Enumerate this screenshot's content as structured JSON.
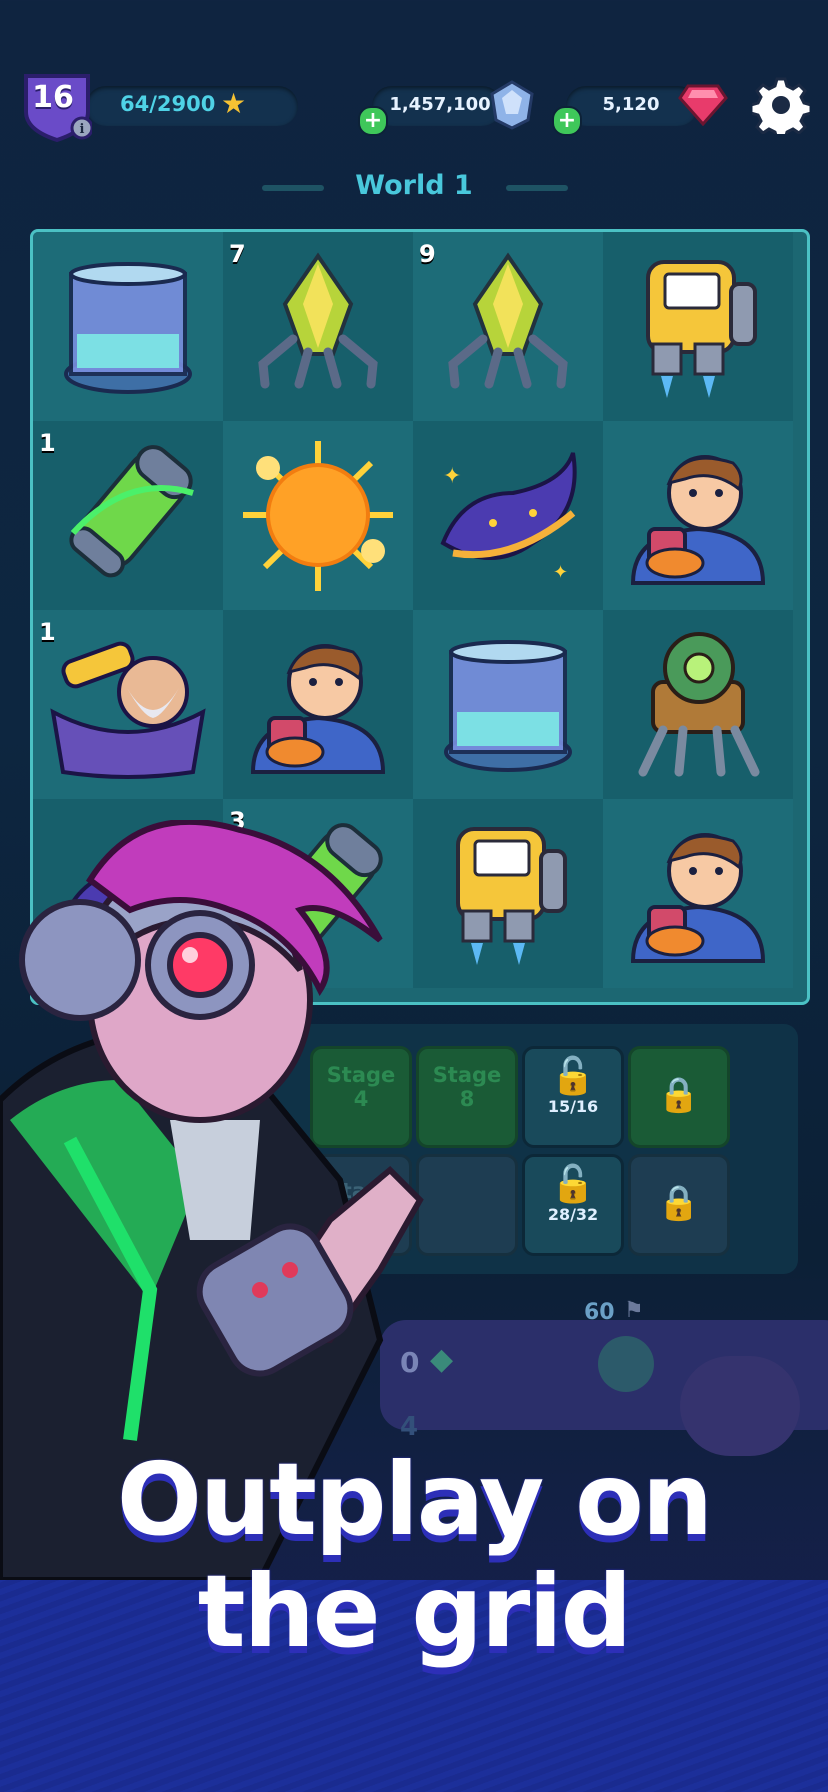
{
  "header": {
    "level": "16",
    "xp": "64/2900",
    "coins": "1,457,100",
    "gems": "5,120"
  },
  "world_title": "World 1",
  "grid": {
    "cells": [
      {
        "item": "cryo-tank-icon",
        "count": ""
      },
      {
        "item": "crystal-drone-icon",
        "count": "7"
      },
      {
        "item": "crystal-drone-icon",
        "count": "9"
      },
      {
        "item": "jetpack-icon",
        "count": ""
      },
      {
        "item": "plant-capsule-icon",
        "count": "1"
      },
      {
        "item": "sun-icon",
        "count": ""
      },
      {
        "item": "nebula-icon",
        "count": ""
      },
      {
        "item": "kid-with-jar-icon",
        "count": ""
      },
      {
        "item": "astronomer-icon",
        "count": "1"
      },
      {
        "item": "kid-with-jar-icon",
        "count": ""
      },
      {
        "item": "cryo-tank-icon",
        "count": ""
      },
      {
        "item": "robot-walker-icon",
        "count": ""
      },
      {
        "item": "nebula-icon",
        "count": ""
      },
      {
        "item": "plant-capsule-icon",
        "count": "3"
      },
      {
        "item": "jetpack-icon",
        "count": ""
      },
      {
        "item": "kid-with-jar-icon",
        "count": ""
      }
    ]
  },
  "stages": {
    "row1": [
      {
        "label_line1": "Stage",
        "label_line2": "4"
      },
      {
        "label_line1": "Stage",
        "label_line2": "8"
      },
      {
        "progress": "15/16"
      },
      {
        "locked": true
      }
    ],
    "row2": [
      {
        "label_line1": "Stage",
        "label_line2": ""
      },
      {
        "label_line1": "ge",
        "label_line2": ""
      },
      {
        "progress": "28/32"
      },
      {
        "locked": true
      }
    ]
  },
  "bottom": {
    "distance": "60",
    "crystals": "0",
    "moves": "4"
  },
  "headline": {
    "line1": "Outplay on",
    "line2": "the grid"
  },
  "colors": {
    "accent": "#4bc1c4",
    "headline_shadow": "#2d2fb8",
    "gem": "#e83b6b",
    "plus": "#3fc75a"
  }
}
